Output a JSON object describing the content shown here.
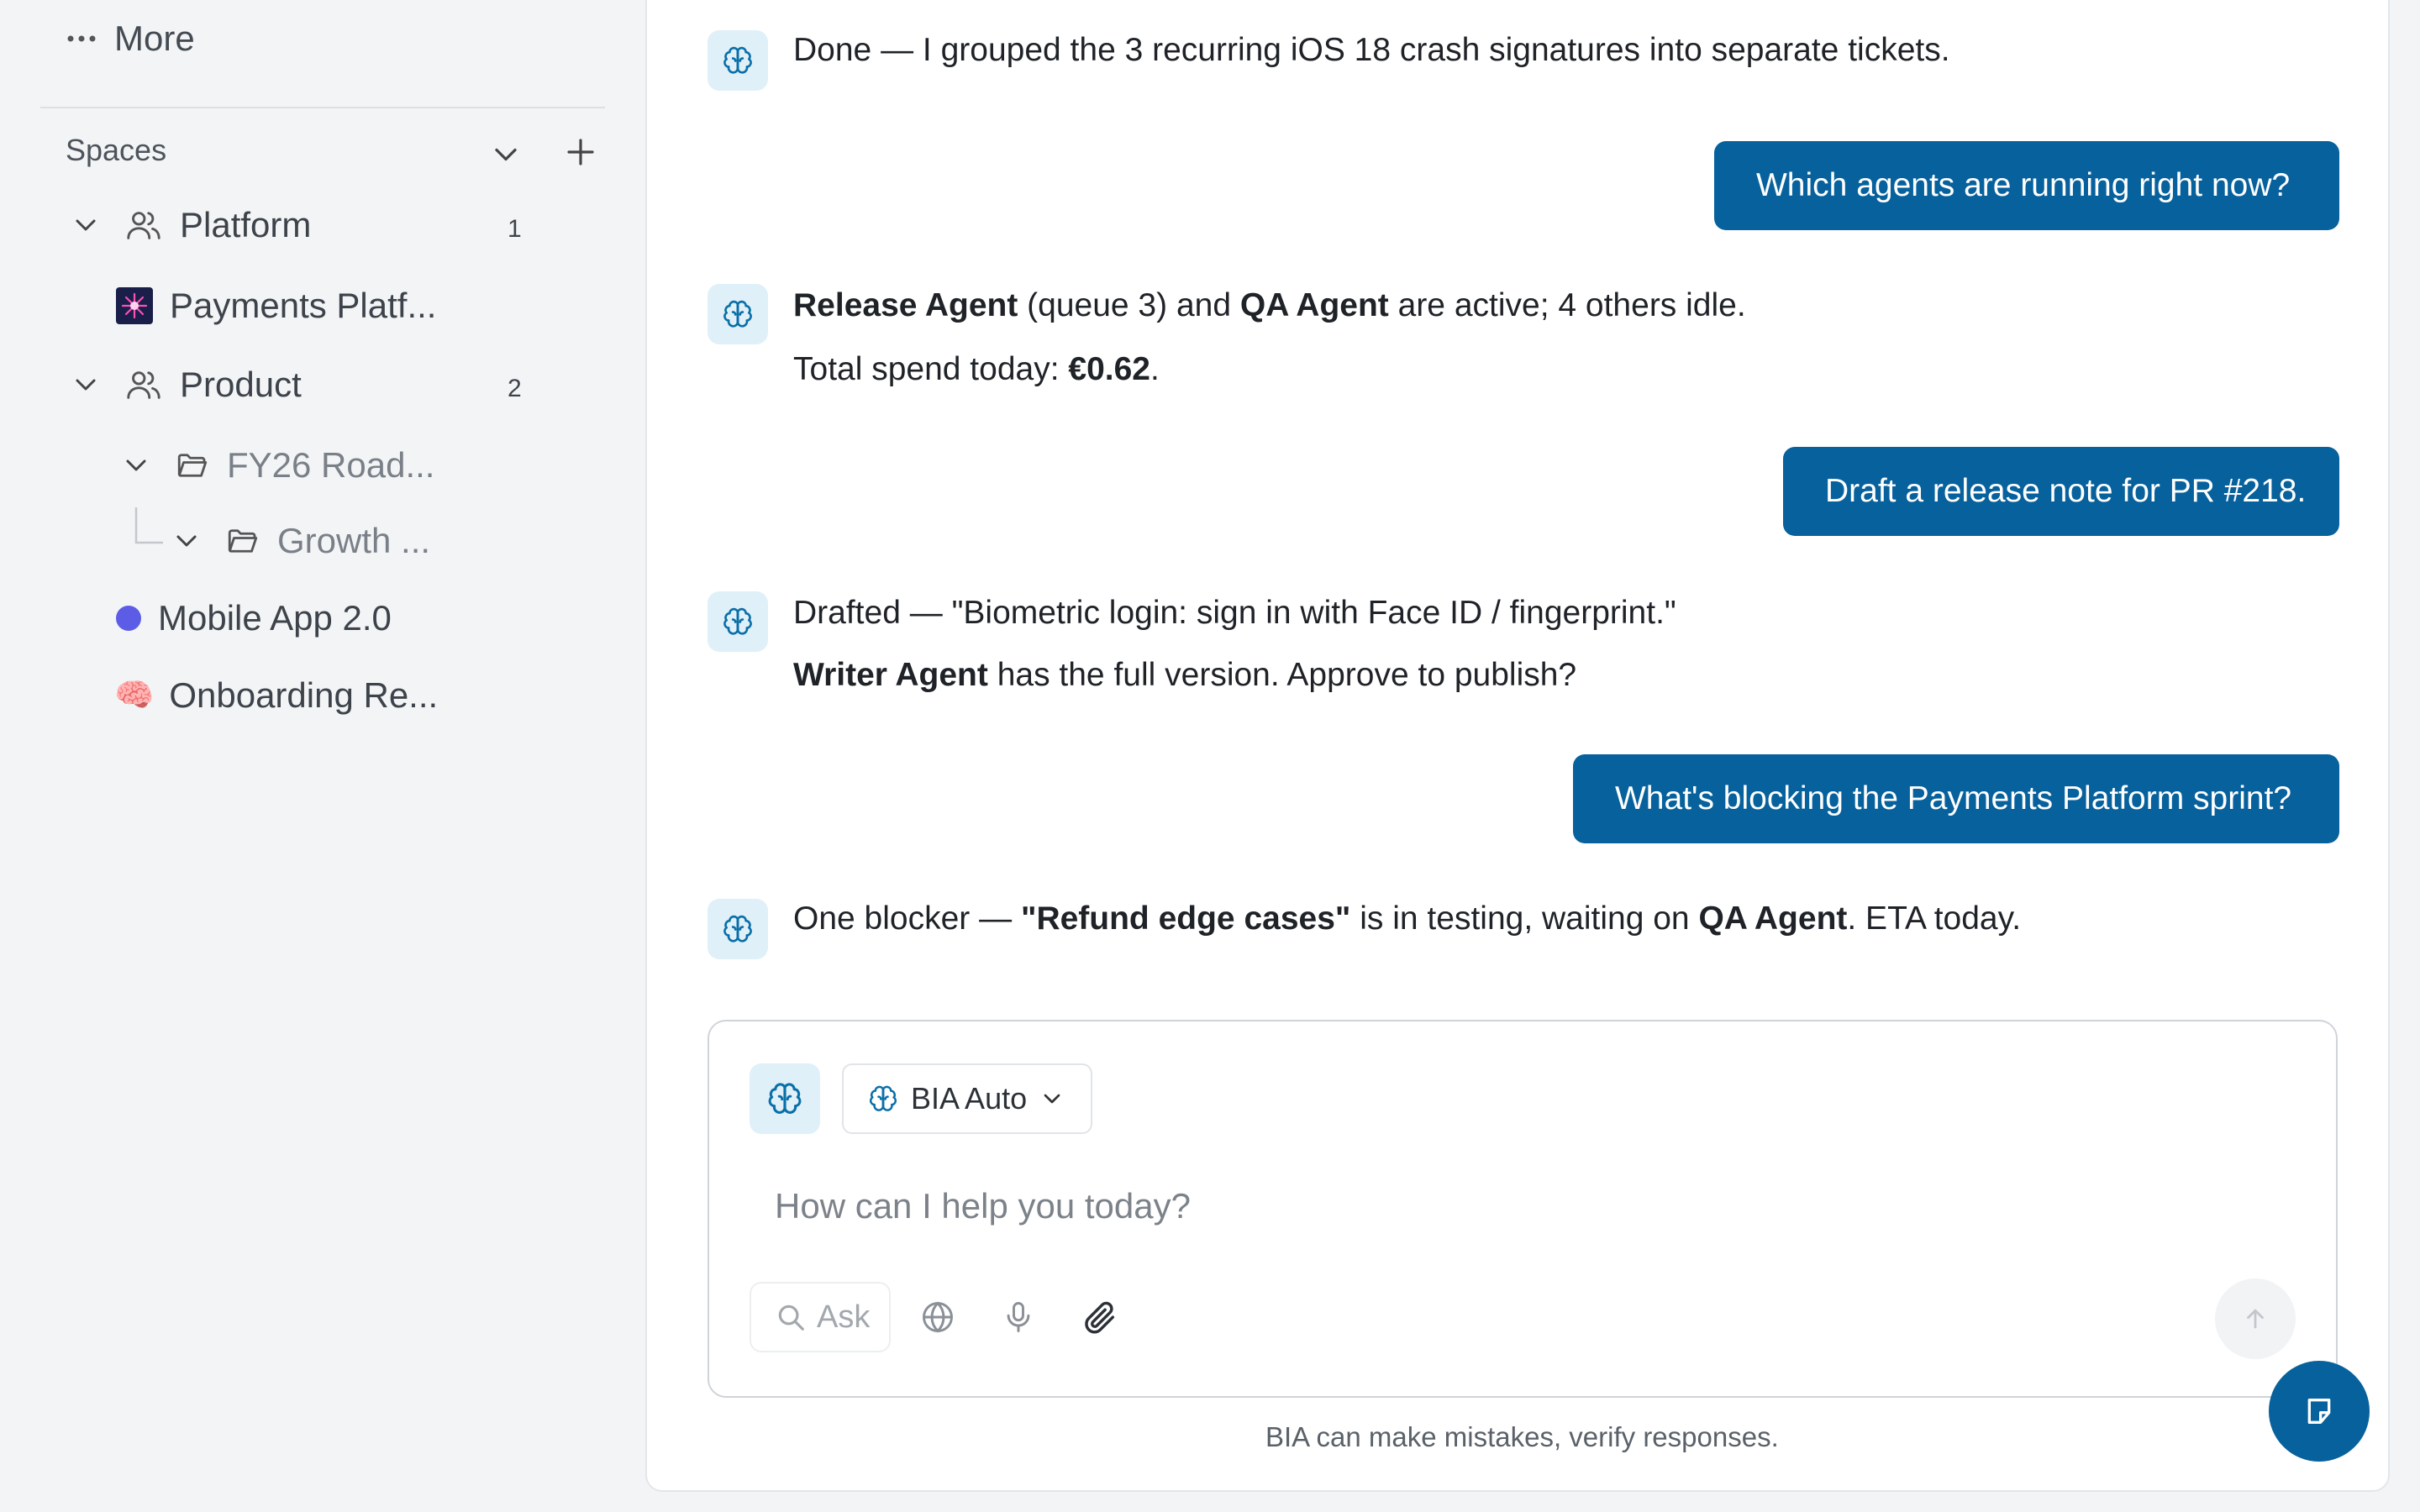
{
  "sidebar": {
    "more_label": "More",
    "spaces_label": "Spaces",
    "items": [
      {
        "label": "Platform",
        "count": "1"
      },
      {
        "label": "Payments Platf..."
      },
      {
        "label": "Product",
        "count": "2"
      },
      {
        "label": "FY26 Road..."
      },
      {
        "label": "Growth ..."
      },
      {
        "label": "Mobile App 2.0"
      },
      {
        "label": "Onboarding Re..."
      }
    ]
  },
  "chat": {
    "m1": {
      "text": "Done — I grouped the 3 recurring iOS 18 crash signatures into separate tickets."
    },
    "u1": "Which agents are running right now?",
    "m2": {
      "a1": "Release Agent",
      "a2": " (queue 3) and ",
      "a3": "QA Agent",
      "a4": " are active; 4 others idle.",
      "b1": "Total spend today: ",
      "b2": "€0.62",
      "b3": "."
    },
    "u2": "Draft a release note for PR #218.",
    "m3": {
      "a1": "Drafted — \"Biometric login: sign in with Face ID / fingerprint.\"",
      "b1": "Writer Agent",
      "b2": " has the full version. Approve to publish?"
    },
    "u3": "What's blocking the Payments Platform sprint?",
    "m4": {
      "a1": "One blocker — ",
      "a2": "\"Refund edge cases\"",
      "a3": " is in testing, waiting on ",
      "a4": "QA Agent",
      "a5": ". ETA today."
    }
  },
  "composer": {
    "model_label": "BIA Auto",
    "placeholder": "How can I help you today?",
    "ask_label": "Ask"
  },
  "disclaimer": "BIA can make mistakes, verify responses.",
  "colors": {
    "accent": "#07619c",
    "avatar_bg": "#dff0f8",
    "status_dot": "#5c5ce6"
  }
}
